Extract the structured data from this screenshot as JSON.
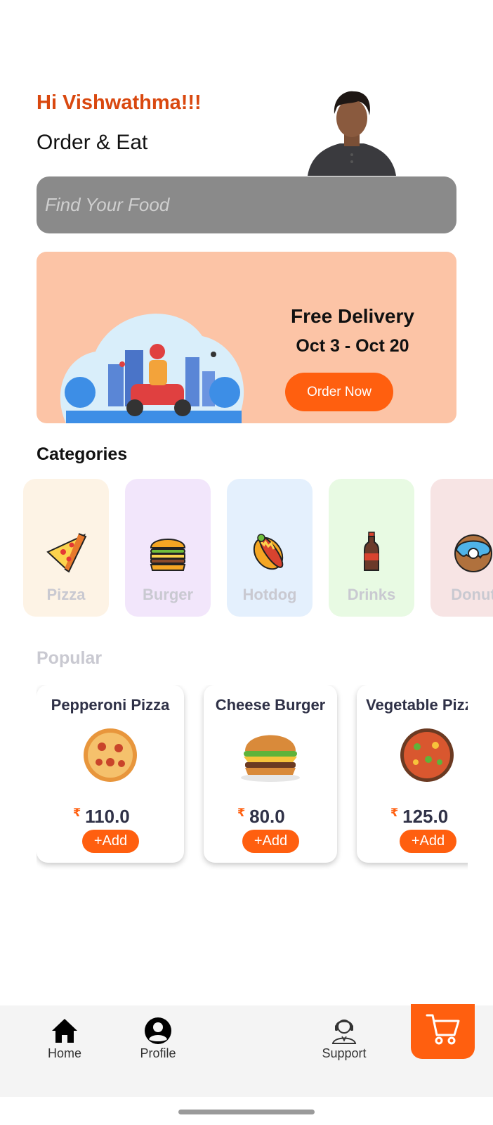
{
  "header": {
    "greeting": "Hi Vishwathma!!!",
    "tagline": "Order & Eat"
  },
  "search": {
    "placeholder": "Find Your Food"
  },
  "promo": {
    "title": "Free Delivery",
    "dates": "Oct 3 - Oct 20",
    "button_label": "Order Now"
  },
  "categories": {
    "title": "Categories",
    "items": [
      {
        "label": "Pizza",
        "icon": "pizza-icon",
        "bg": "#fdf3e5"
      },
      {
        "label": "Burger",
        "icon": "burger-icon",
        "bg": "#f2e6fb"
      },
      {
        "label": "Hotdog",
        "icon": "hotdog-icon",
        "bg": "#e4f0fd"
      },
      {
        "label": "Drinks",
        "icon": "drink-icon",
        "bg": "#e8fae3"
      },
      {
        "label": "Donut",
        "icon": "donut-icon",
        "bg": "#f7e4e4"
      }
    ]
  },
  "popular": {
    "title": "Popular",
    "currency": "₹",
    "items": [
      {
        "name": "Pepperoni Pizza",
        "price": "110.0",
        "add_label": "+Add"
      },
      {
        "name": "Cheese Burger",
        "price": "80.0",
        "add_label": "+Add"
      },
      {
        "name": "Vegetable Pizza",
        "price": "125.0",
        "add_label": "+Add"
      }
    ]
  },
  "nav": {
    "items": [
      {
        "label": "Home",
        "icon": "home-icon"
      },
      {
        "label": "Profile",
        "icon": "profile-icon"
      },
      {
        "label": "Support",
        "icon": "support-icon"
      }
    ],
    "cart_icon": "cart-icon"
  },
  "colors": {
    "accent": "#ff5f0f",
    "greeting": "#d9480f",
    "promo_bg": "#fcc4a6",
    "search_bg": "#8a8a8a"
  }
}
